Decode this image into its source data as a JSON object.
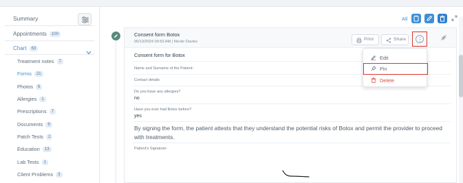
{
  "sidebar": {
    "summary_label": "Summary",
    "items": [
      {
        "label": "Appointments",
        "count": "100"
      },
      {
        "label": "Chart",
        "count": "63"
      },
      {
        "label": "Treatment notes",
        "count": "7"
      },
      {
        "label": "Forms",
        "count": "21"
      },
      {
        "label": "Photos",
        "count": "6"
      },
      {
        "label": "Allergies",
        "count": "1"
      },
      {
        "label": "Prescriptions",
        "count": "7"
      },
      {
        "label": "Documents",
        "count": "9"
      },
      {
        "label": "Patch Tests",
        "count": "2"
      },
      {
        "label": "Education",
        "count": "13"
      },
      {
        "label": "Lab Tests",
        "count": "1"
      },
      {
        "label": "Client Problems",
        "count": "3"
      }
    ]
  },
  "toolbar": {
    "all_label": "All",
    "colors": {
      "accent": "#3d8fd8",
      "doc": "#3d8fd8",
      "edit": "#3d8fd8",
      "trash": "#2f80d1"
    }
  },
  "card": {
    "title": "Consent form Botox",
    "subtitle": "06/13/2024 09:53 AM | Nicole Davies",
    "print_label": "Print",
    "share_label": "Share",
    "form_heading": "Consent form for Botox",
    "fields": [
      {
        "label": "Name and Surname of the Patient:",
        "value": ""
      },
      {
        "label": "Contact details",
        "value": ""
      },
      {
        "label": "Do you have any allergies?",
        "value": "no"
      },
      {
        "label": "Have you ever had Botox before?",
        "value": "yes"
      }
    ],
    "statement": "By signing the form, the patient attests that they understand the potential risks of Botox and permit the provider to proceed with treatments.",
    "signature_label": "Patient's Signature"
  },
  "menu": {
    "items": [
      {
        "label": "Edit",
        "icon": "edit-icon"
      },
      {
        "label": "Pin",
        "icon": "pin-icon"
      },
      {
        "label": "Delete",
        "icon": "trash-icon"
      }
    ]
  },
  "colors": {
    "highlight": "#d9342b",
    "danger": "#e04a3f",
    "timeline_dot": "#5a8a7a"
  }
}
